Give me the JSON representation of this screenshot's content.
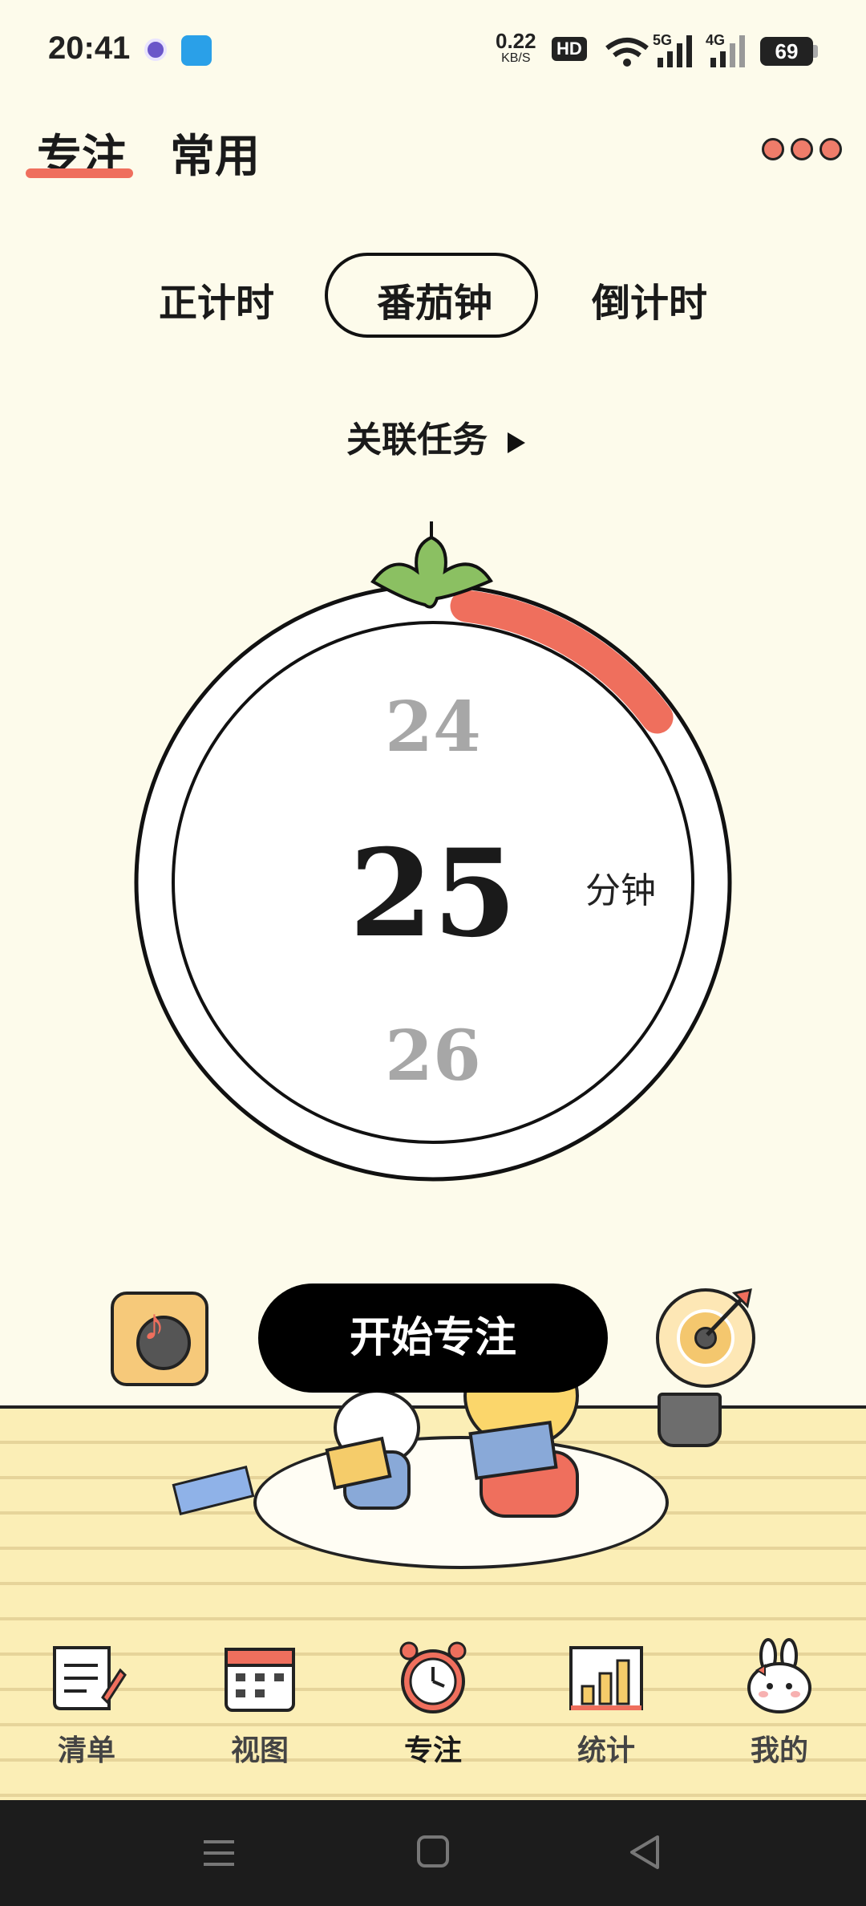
{
  "status_bar": {
    "time": "20:41",
    "net_speed": "0.22",
    "net_speed_unit": "KB/S",
    "hd": "HD",
    "signal1_label": "5G",
    "signal2_label": "4G",
    "battery": "69"
  },
  "header": {
    "tabs": [
      "专注",
      "常用"
    ],
    "active_tab": "专注",
    "more_icon": "more-dots-icon"
  },
  "modes": {
    "items": [
      "正计时",
      "番茄钟",
      "倒计时"
    ],
    "active": "番茄钟"
  },
  "link_task": {
    "label": "关联任务",
    "icon": "triangle-right-icon"
  },
  "timer": {
    "prev": "24",
    "current": "25",
    "next": "26",
    "unit": "分钟",
    "progress_fraction": 0.13,
    "accent": "#ef6f5d"
  },
  "actions": {
    "start_label": "开始专注",
    "music_icon": "music-note-icon",
    "target_icon": "target-icon"
  },
  "bottom_nav": {
    "items": [
      {
        "label": "清单",
        "icon": "list-note-icon"
      },
      {
        "label": "视图",
        "icon": "calendar-icon"
      },
      {
        "label": "专注",
        "icon": "alarm-clock-icon"
      },
      {
        "label": "统计",
        "icon": "bar-chart-icon"
      },
      {
        "label": "我的",
        "icon": "bunny-icon"
      }
    ],
    "active": "专注"
  },
  "system_nav": {
    "icons": [
      "menu-icon",
      "home-icon",
      "back-icon"
    ]
  }
}
